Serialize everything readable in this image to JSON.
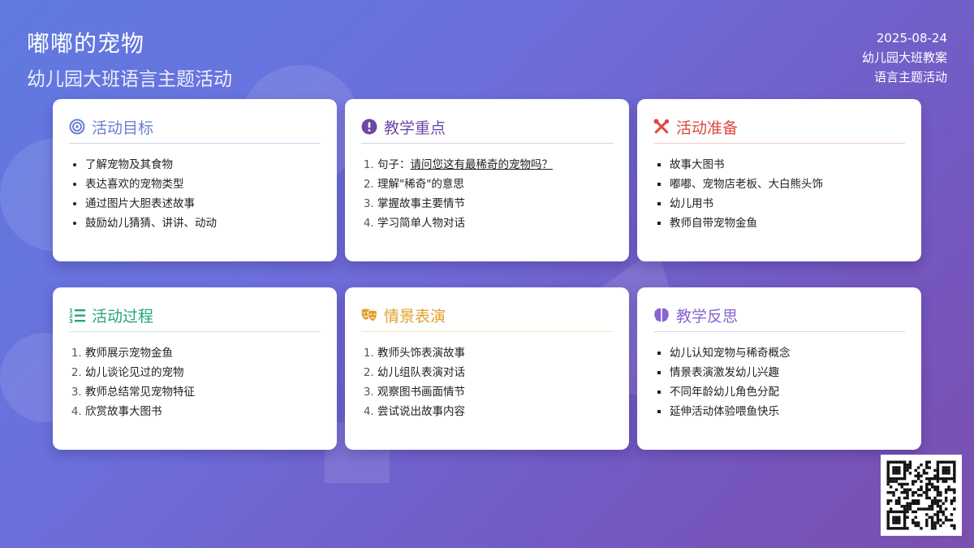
{
  "header": {
    "title": "嘟嘟的宠物",
    "subtitle": "幼儿园大班语言主题活动",
    "date": "2025-08-24",
    "meta1": "幼儿园大班教案",
    "meta2": "语言主题活动"
  },
  "cards": [
    {
      "title": "活动目标",
      "icon": "target-icon",
      "color": "#6a7fd6",
      "items": [
        "了解宠物及其食物",
        "表达喜欢的宠物类型",
        "通过图片大胆表述故事",
        "鼓励幼儿猜猜、讲讲、动动"
      ]
    },
    {
      "title": "教学重点",
      "icon": "exclamation-icon",
      "color": "#6b4aa6",
      "items": [
        "句子：",
        "理解\"稀奇\"的意思",
        "掌握故事主要情节",
        "学习简单人物对话"
      ],
      "underline": "请问您这有最稀奇的宠物吗？"
    },
    {
      "title": "活动准备",
      "icon": "tools-icon",
      "color": "#e0473c",
      "items": [
        "故事大图书",
        "嘟嘟、宠物店老板、大白熊头饰",
        "幼儿用书",
        "教师自带宠物金鱼"
      ]
    },
    {
      "title": "活动过程",
      "icon": "list-icon",
      "color": "#23a57b",
      "items": [
        "教师展示宠物金鱼",
        "幼儿谈论见过的宠物",
        "教师总结常见宠物特征",
        "欣赏故事大图书"
      ]
    },
    {
      "title": "情景表演",
      "icon": "masks-icon",
      "color": "#e0a02a",
      "items": [
        "教师头饰表演故事",
        "幼儿组队表演对话",
        "观察图书画面情节",
        "尝试说出故事内容"
      ]
    },
    {
      "title": "教学反思",
      "icon": "brain-icon",
      "color": "#8a63d2",
      "items": [
        "幼儿认知宠物与稀奇概念",
        "情景表演激发幼儿兴趣",
        "不同年龄幼儿角色分配",
        "延伸活动体验喂鱼快乐"
      ]
    }
  ]
}
